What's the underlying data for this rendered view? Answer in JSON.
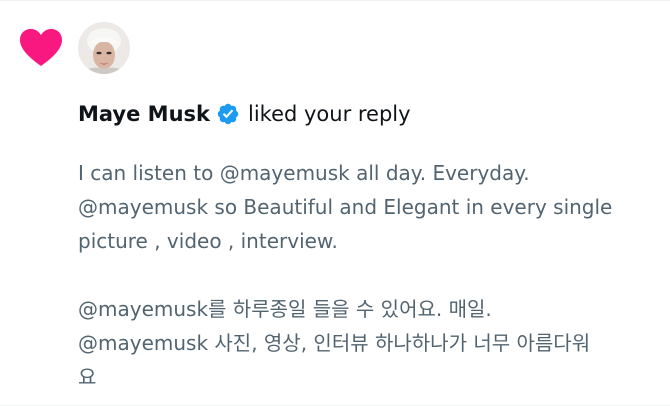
{
  "notification": {
    "user_name": "Maye Musk",
    "action": "liked your reply",
    "reply_lines": [
      "I can listen to @mayemusk all day. Everyday.",
      "@mayemusk so Beautiful and Elegant in every single",
      "picture , video , interview.",
      "@mayemusk를 하루종일 들을 수 있어요. 매일.",
      "@mayemusk 사진, 영상, 인터뷰 하나하나가 너무 아름다워",
      "요"
    ]
  },
  "icons": {
    "like": "heart-icon",
    "verified": "verified-badge-icon"
  },
  "colors": {
    "like_heart": "#f91880",
    "verified_badge": "#1d9bf0",
    "primary_text": "#0f1419",
    "secondary_text": "#536471"
  }
}
